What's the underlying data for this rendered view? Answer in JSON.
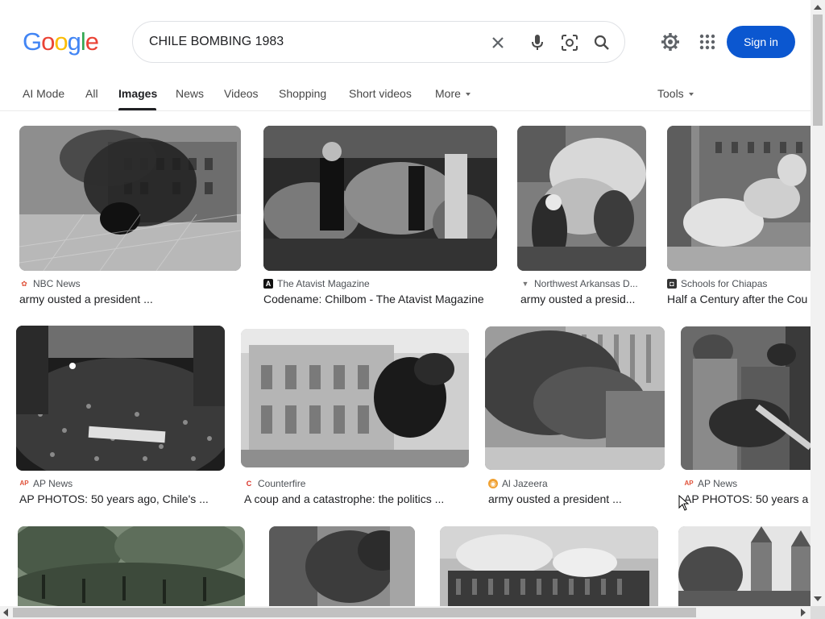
{
  "logo": {
    "letters": [
      "G",
      "o",
      "o",
      "g",
      "l",
      "e"
    ],
    "colors": [
      "#4285f4",
      "#ea4335",
      "#fbbc05",
      "#4285f4",
      "#34a853",
      "#ea4335"
    ]
  },
  "search": {
    "query": "CHILE BOMBING 1983"
  },
  "header": {
    "signin_label": "Sign in"
  },
  "tabs": [
    {
      "label": "AI Mode",
      "active": false
    },
    {
      "label": "All",
      "active": false
    },
    {
      "label": "Images",
      "active": true
    },
    {
      "label": "News",
      "active": false
    },
    {
      "label": "Videos",
      "active": false
    },
    {
      "label": "Shopping",
      "active": false
    },
    {
      "label": "Short videos",
      "active": false
    },
    {
      "label": "More",
      "active": false
    }
  ],
  "tools_label": "Tools",
  "results": [
    {
      "source": "NBC News",
      "caption": "army ousted a president ...",
      "fav": "nbc"
    },
    {
      "source": "The Atavist Magazine",
      "caption": "Codename: Chilbom - The Atavist Magazine",
      "fav": "A"
    },
    {
      "source": "Northwest Arkansas D...",
      "caption": "army ousted a presid...",
      "fav": "nwa"
    },
    {
      "source": "Schools for Chiapas",
      "caption": "Half a Century after the Cou",
      "fav": "sc"
    },
    {
      "source": "AP News",
      "caption": "AP PHOTOS: 50 years ago, Chile's ...",
      "fav": "AP"
    },
    {
      "source": "Counterfire",
      "caption": "A coup and a catastrophe: the politics ...",
      "fav": "C"
    },
    {
      "source": "Al Jazeera",
      "caption": "army ousted a president ...",
      "fav": "aj"
    },
    {
      "source": "AP News",
      "caption": "AP PHOTOS: 50 years a",
      "fav": "AP"
    }
  ],
  "colors": {
    "accent": "#0b57d0"
  }
}
